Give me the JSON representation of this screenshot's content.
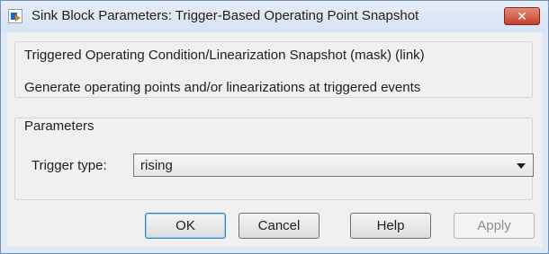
{
  "window": {
    "title": "Sink Block Parameters: Trigger-Based Operating Point Snapshot",
    "close_glyph": "✕"
  },
  "description": {
    "title": "Triggered Operating Condition/Linearization Snapshot (mask) (link)",
    "text": "Generate operating points and/or linearizations at triggered events"
  },
  "parameters": {
    "legend": "Parameters",
    "trigger_type_label": "Trigger type:",
    "trigger_type_value": "rising"
  },
  "buttons": {
    "ok": "OK",
    "cancel": "Cancel",
    "help": "Help",
    "apply": "Apply"
  },
  "colors": {
    "close_button": "#c4412c",
    "default_button_border": "#3c7fb1"
  }
}
